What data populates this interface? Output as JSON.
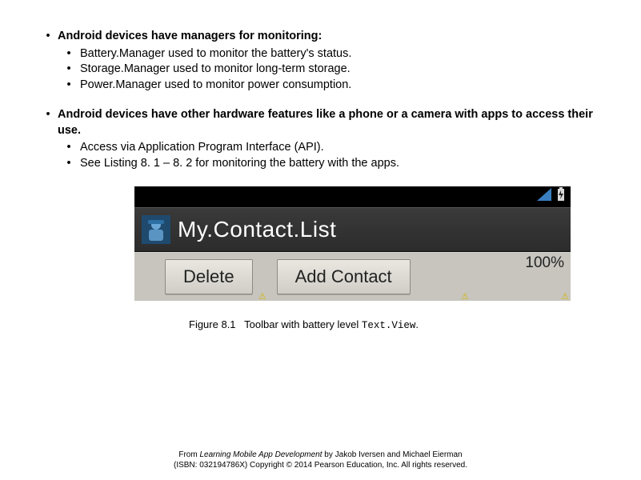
{
  "bullets": {
    "b1": {
      "head": "Android devices have managers for monitoring:",
      "s1": "Battery.Manager used to monitor the battery's status.",
      "s2": "Storage.Manager used to monitor long-term storage.",
      "s3": "Power.Manager used to monitor power consumption."
    },
    "b2": {
      "head": "Android devices have other hardware features like a phone or a camera with apps to access their use.",
      "s1": "Access via Application Program Interface (API).",
      "s2": "See Listing 8. 1 – 8. 2 for monitoring the battery with the apps."
    }
  },
  "android": {
    "app_title": "My.Contact.List",
    "btn_delete": "Delete",
    "btn_add": "Add Contact",
    "battery_pct": "100%"
  },
  "caption": {
    "label": "Figure 8.1",
    "text": "Toolbar with battery level",
    "code": "Text.View",
    "period": "."
  },
  "footer": {
    "line1a": "From ",
    "line1b": "Learning Mobile App Development",
    "line1c": " by Jakob Iversen and Michael Eierman",
    "line2": "(ISBN: 032194786X) Copyright © 2014 Pearson Education, Inc. All rights reserved."
  }
}
